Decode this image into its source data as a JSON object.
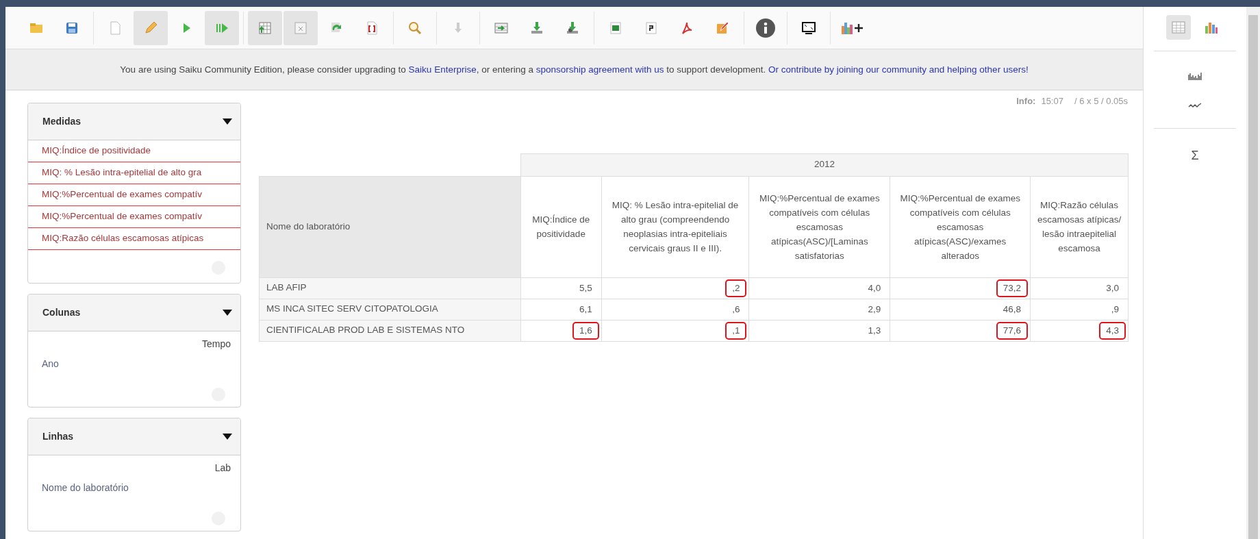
{
  "toolbar": [
    {
      "kind": "folder",
      "pressed": false
    },
    {
      "kind": "save",
      "pressed": false
    },
    {
      "kind": "new",
      "pressed": false
    },
    {
      "kind": "pencil",
      "pressed": true
    },
    {
      "kind": "play",
      "pressed": false
    },
    {
      "kind": "play-all",
      "pressed": true
    },
    {
      "kind": "table-up",
      "pressed": true
    },
    {
      "kind": "table-x",
      "pressed": true
    },
    {
      "kind": "swap",
      "pressed": false
    },
    {
      "kind": "brackets",
      "pressed": false
    },
    {
      "kind": "search",
      "pressed": false
    },
    {
      "kind": "down",
      "pressed": false
    },
    {
      "kind": "table-arrow",
      "pressed": false
    },
    {
      "kind": "download",
      "pressed": false
    },
    {
      "kind": "download-alt",
      "pressed": false
    },
    {
      "kind": "excel",
      "pressed": false
    },
    {
      "kind": "doc",
      "pressed": false
    },
    {
      "kind": "pdf",
      "pressed": false
    },
    {
      "kind": "edit",
      "pressed": false
    },
    {
      "kind": "info",
      "pressed": false
    },
    {
      "kind": "screen",
      "pressed": false
    },
    {
      "kind": "chart-add",
      "pressed": false
    }
  ],
  "banner": [
    {
      "kind": "text",
      "text": "You are using Saiku Community Edition, please consider upgrading to "
    },
    {
      "kind": "link",
      "text": "Saiku Enterprise"
    },
    {
      "kind": "text",
      "text": ", or entering a "
    },
    {
      "kind": "link",
      "text": "sponsorship agreement with us"
    },
    {
      "kind": "text",
      "text": " to support development. "
    },
    {
      "kind": "link",
      "text": "Or contribute by joining our community and helping other users!"
    }
  ],
  "panels": [
    {
      "title": "Medidas",
      "kind": "measures",
      "items": [
        {
          "text": "MIQ:Índice de positividade"
        },
        {
          "text": "MIQ: % Lesão intra-epitelial de alto gra"
        },
        {
          "text": "MIQ:%Percentual de exames compatív"
        },
        {
          "text": "MIQ:%Percentual de exames compatív"
        },
        {
          "text": "MIQ:Razão células escamosas atípicas"
        }
      ]
    },
    {
      "title": "Colunas",
      "kind": "dimension",
      "dimension": "Tempo",
      "items": [
        {
          "text": "Ano"
        }
      ]
    },
    {
      "title": "Linhas",
      "kind": "dimension",
      "dimension": "Lab",
      "items": [
        {
          "text": "Nome do laboratório"
        }
      ]
    }
  ],
  "info": {
    "label": "Info:",
    "time": "15:07",
    "stats": "/ 6 x 5 / 0.05s"
  },
  "table": {
    "group": "2012",
    "row_header": "Nome do laboratório",
    "columns": [
      "MIQ:Índice de positividade",
      "MIQ: % Lesão intra-epitelial de alto grau (compreendendo neoplasias intra-epiteliais cervicais graus II e III).",
      "MIQ:%Percentual de exames compatíveis com células escamosas atípicas(ASC)/[Laminas satisfatorias",
      "MIQ:%Percentual de exames compatíveis com células escamosas atípicas(ASC)/exames alterados",
      "MIQ:Razão células escamosas atípicas/ lesão intraepitelial escamosa"
    ],
    "rows": [
      {
        "name": "LAB AFIP",
        "cells": [
          {
            "value": "5,5",
            "highlighted": false
          },
          {
            "value": ",2",
            "highlighted": true
          },
          {
            "value": "4,0",
            "highlighted": false
          },
          {
            "value": "73,2",
            "highlighted": true
          },
          {
            "value": "3,0",
            "highlighted": false
          }
        ]
      },
      {
        "name": "MS INCA SITEC SERV CITOPATOLOGIA",
        "cells": [
          {
            "value": "6,1",
            "highlighted": false
          },
          {
            "value": ",6",
            "highlighted": false
          },
          {
            "value": "2,9",
            "highlighted": false
          },
          {
            "value": "46,8",
            "highlighted": false
          },
          {
            "value": ",9",
            "highlighted": false
          }
        ]
      },
      {
        "name": "CIENTIFICALAB PROD LAB E SISTEMAS NTO",
        "cells": [
          {
            "value": "1,6",
            "highlighted": true
          },
          {
            "value": ",1",
            "highlighted": true
          },
          {
            "value": "1,3",
            "highlighted": false
          },
          {
            "value": "77,6",
            "highlighted": true
          },
          {
            "value": "4,3",
            "highlighted": true
          }
        ]
      }
    ]
  },
  "side": {
    "modes": [
      {
        "kind": "table",
        "selected": true
      },
      {
        "kind": "chart",
        "selected": false
      }
    ],
    "tools": [
      {
        "kind": "bars"
      },
      {
        "kind": "wave"
      }
    ],
    "sum": "Σ"
  }
}
